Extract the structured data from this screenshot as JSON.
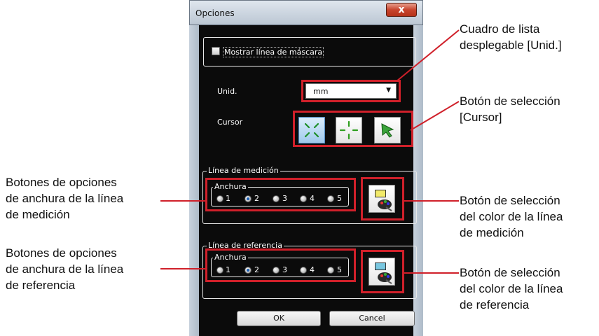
{
  "dialog": {
    "title": "Opciones",
    "close_glyph": "x",
    "mask_checkbox": {
      "label": "Mostrar línea de máscara",
      "checked": false
    },
    "unit": {
      "label": "Unid.",
      "selected": "mm"
    },
    "cursor": {
      "label": "Cursor",
      "options": [
        "cross-diagonal-icon",
        "cross-plus-icon",
        "arrow-pointer-icon"
      ],
      "selected_index": 0
    },
    "measure_line": {
      "group_label": "Línea de medición",
      "width_label": "Anchura",
      "options": [
        "1",
        "2",
        "3",
        "4",
        "5"
      ],
      "selected": "2",
      "swatch_color": "#f2ea6a"
    },
    "reference_line": {
      "group_label": "Línea de referencia",
      "width_label": "Anchura",
      "options": [
        "1",
        "2",
        "3",
        "4",
        "5"
      ],
      "selected": "2",
      "swatch_color": "#79c7e0"
    },
    "ok_label": "OK",
    "cancel_label": "Cancel"
  },
  "annotations": {
    "unit_dropdown": [
      "Cuadro de lista",
      "desplegable [Unid.]"
    ],
    "cursor_button": [
      "Botón de selección",
      "[Cursor]"
    ],
    "measure_width": [
      "Botones de opciones",
      "de anchura de la línea",
      "de medición"
    ],
    "reference_width": [
      "Botones de opciones",
      "de anchura de la línea",
      "de referencia"
    ],
    "measure_color": [
      "Botón de selección",
      "del color de la línea",
      "de medición"
    ],
    "reference_color": [
      "Botón de selección",
      "del color de la línea",
      "de referencia"
    ]
  },
  "colors": {
    "highlight": "#d0202a",
    "dialog_bg": "#0b0b0b"
  }
}
